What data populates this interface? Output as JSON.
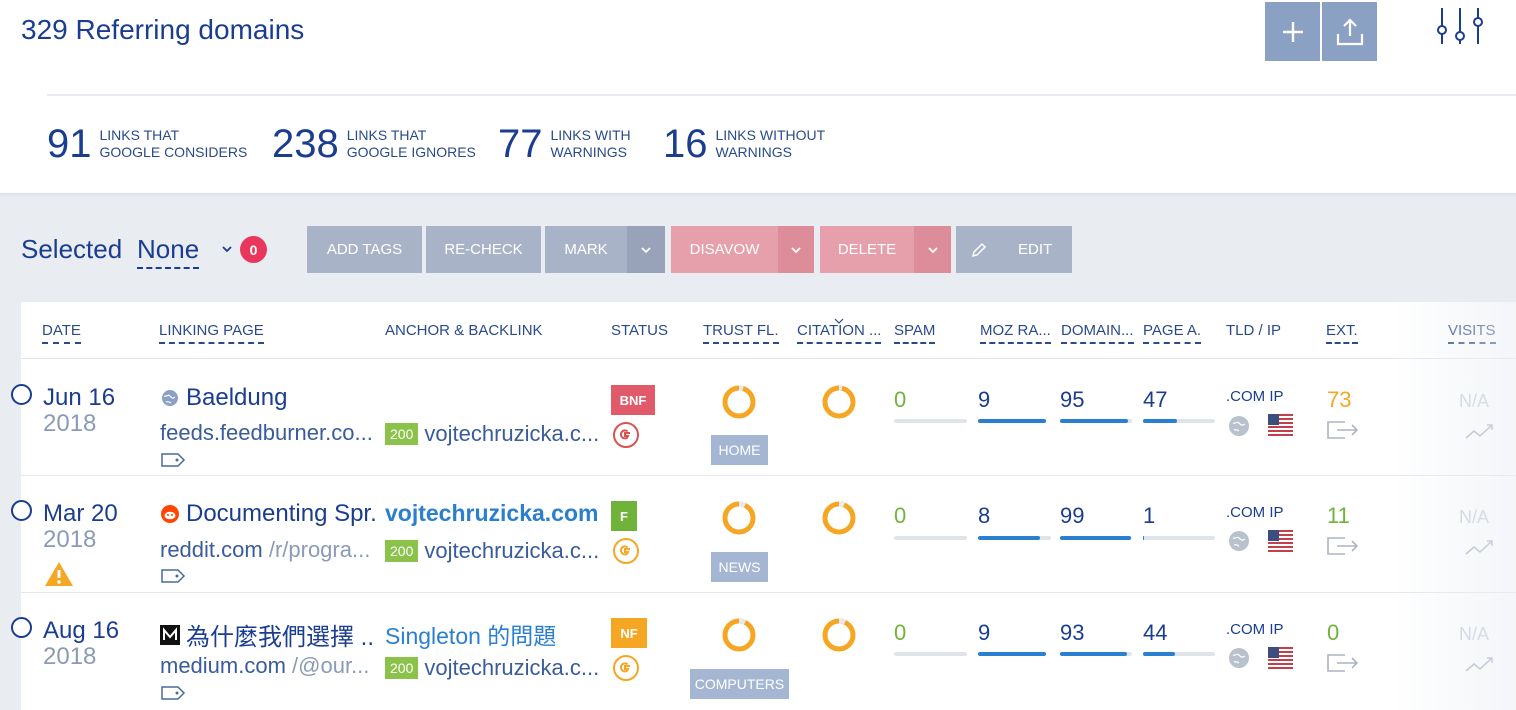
{
  "header": {
    "title": "329 Referring domains",
    "add_label": "+",
    "stats": [
      {
        "num": "91",
        "label1": "LINKS THAT",
        "label2": "GOOGLE CONSIDERS"
      },
      {
        "num": "238",
        "label1": "LINKS THAT",
        "label2": "GOOGLE IGNORES"
      },
      {
        "num": "77",
        "label1": "LINKS WITH",
        "label2": "WARNINGS"
      },
      {
        "num": "16",
        "label1": "LINKS WITHOUT",
        "label2": "WARNINGS"
      }
    ]
  },
  "toolbar": {
    "selected_label": "Selected",
    "selected_value": "None",
    "selected_count": "0",
    "add_tags": "ADD TAGS",
    "recheck": "RE-CHECK",
    "mark": "MARK",
    "disavow": "DISAVOW",
    "delete": "DELETE",
    "edit": "EDIT"
  },
  "columns": {
    "date": "DATE",
    "linking_page": "LINKING PAGE",
    "anchor": "ANCHOR & BACKLINK",
    "status": "STATUS",
    "trust": "TRUST FL.",
    "citation": "CITATION ...",
    "spam": "SPAM",
    "moz": "MOZ RA...",
    "domain": "DOMAIN...",
    "page": "PAGE A.",
    "tld": "TLD / IP",
    "ext": "EXT.",
    "visits": "VISITS"
  },
  "colors": {
    "accent": "#1a3d8f",
    "link": "#2a7fd0",
    "green": "#8bc34a",
    "orange": "#f5a623",
    "pink": "#e8365d"
  },
  "rows": [
    {
      "date_md": "Jun 16",
      "date_y": "2018",
      "page_title": "Baeldung",
      "favicon": "globe-icon",
      "url_domain": "feeds.feedburner.co...",
      "url_path": "",
      "anchor": "",
      "backlink_code": "200",
      "backlink": "vojtechruzicka.c...",
      "status": "BNF",
      "status_color": "#e05a6a",
      "g_color": "#d9534f",
      "topic": "HOME",
      "spam": "0",
      "moz": "9",
      "moz_pct": 1.0,
      "domain": "95",
      "domain_pct": 0.95,
      "page": "47",
      "page_pct": 0.47,
      "tld": ".COM IP",
      "ext": "73",
      "ext_color": "orange",
      "visits": "N/A",
      "warning": false
    },
    {
      "date_md": "Mar 20",
      "date_y": "2018",
      "page_title": "Documenting Spr...",
      "favicon": "reddit-icon",
      "url_domain": "reddit.com",
      "url_path": " /r/progra...",
      "anchor": "vojtechruzicka.com...",
      "backlink_code": "200",
      "backlink": "vojtechruzicka.c...",
      "status": "F",
      "status_color": "#6fb33a",
      "g_color": "#f5a623",
      "topic": "NEWS",
      "spam": "0",
      "moz": "8",
      "moz_pct": 0.85,
      "domain": "99",
      "domain_pct": 0.99,
      "page": "1",
      "page_pct": 0.02,
      "tld": ".COM IP",
      "ext": "11",
      "ext_color": "green",
      "visits": "N/A",
      "warning": true
    },
    {
      "date_md": "Aug 16",
      "date_y": "2018",
      "page_title": "為什麼我們選擇 ...",
      "favicon": "medium-icon",
      "url_domain": "medium.com",
      "url_path": " /@our...",
      "anchor": "Singleton 的問題",
      "backlink_code": "200",
      "backlink": "vojtechruzicka.c...",
      "status": "NF",
      "status_color": "#f5a623",
      "g_color": "#f5a623",
      "topic": "COMPUTERS",
      "spam": "0",
      "moz": "9",
      "moz_pct": 1.0,
      "domain": "93",
      "domain_pct": 0.93,
      "page": "44",
      "page_pct": 0.44,
      "tld": ".COM IP",
      "ext": "0",
      "ext_color": "green",
      "visits": "N/A",
      "warning": false
    }
  ]
}
